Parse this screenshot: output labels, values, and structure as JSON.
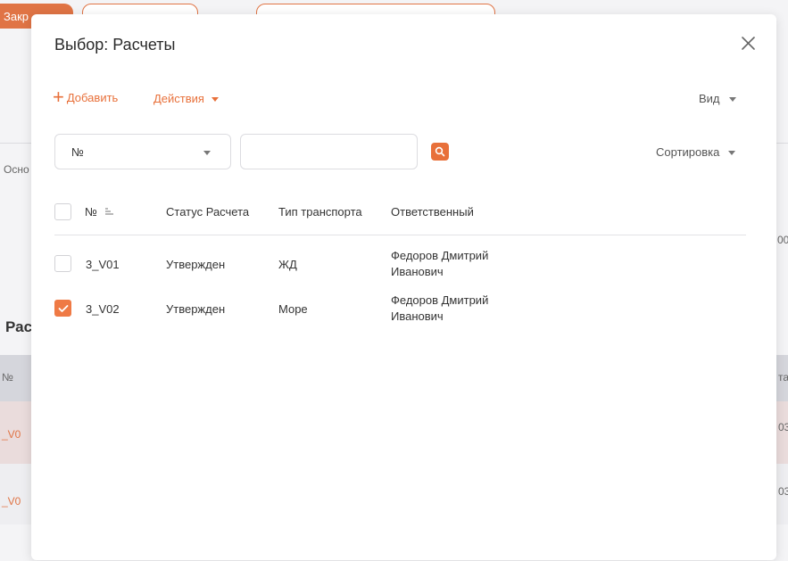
{
  "background": {
    "top_button_label": "Закр",
    "tab_label": "Осно",
    "right_value_1": "00",
    "section_heading": "Рас",
    "table_header_col1": "№",
    "table_header_col_right": "та",
    "row1_id": "_V0",
    "row1_right": "03",
    "row2_id": "_V0",
    "row2_right": "03"
  },
  "modal": {
    "title": "Выбор: Расчеты",
    "toolbar": {
      "add_label": "Добавить",
      "actions_label": "Действия",
      "view_label": "Вид"
    },
    "filter": {
      "field_select_value": "№",
      "search_value": "",
      "search_placeholder": "",
      "sort_label": "Сортировка"
    },
    "table": {
      "columns": [
        "№",
        "Статус Расчета",
        "Тип транспорта",
        "Ответственный"
      ],
      "rows": [
        {
          "number": "3_V01",
          "status": "Утвержден",
          "transport": "ЖД",
          "responsible_line1": "Федоров Дмитрий",
          "responsible_line2": "Иванович",
          "checked": false
        },
        {
          "number": "3_V02",
          "status": "Утвержден",
          "transport": "Море",
          "responsible_line1": "Федоров Дмитрий",
          "responsible_line2": "Иванович",
          "checked": true
        }
      ]
    }
  },
  "colors": {
    "accent": "#e8703a",
    "checkbox_checked": "#ef7a45"
  },
  "icons": [
    "close-icon",
    "plus-icon",
    "caret-down-icon",
    "search-icon",
    "sort-icon",
    "check-icon"
  ]
}
